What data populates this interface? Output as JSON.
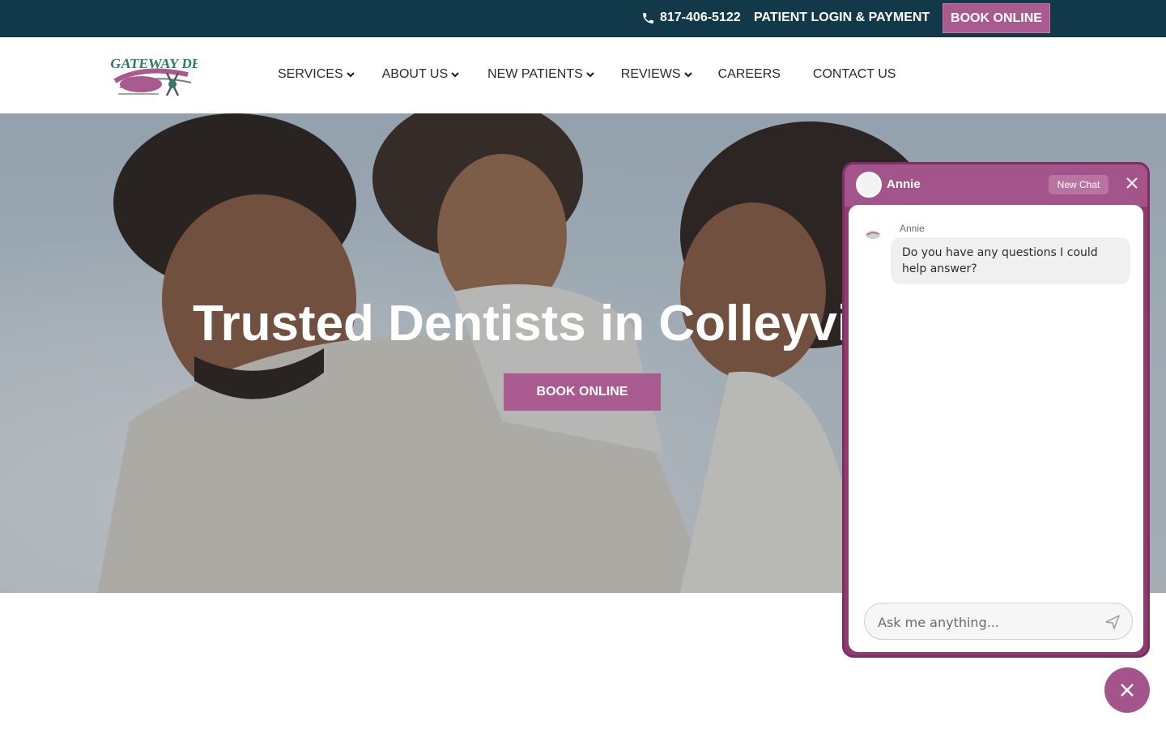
{
  "topbar": {
    "phone": "817-406-5122",
    "login": "PATIENT LOGIN & PAYMENT",
    "book": "BOOK ONLINE",
    "icons": {
      "phone": "phone-icon"
    },
    "colors": {
      "background": "#12394a",
      "accent": "#a95a8f"
    }
  },
  "nav": {
    "logo_text": "GATEWAY DENTAL",
    "items": [
      {
        "label": "SERVICES",
        "dropdown": true
      },
      {
        "label": "ABOUT US",
        "dropdown": true
      },
      {
        "label": "NEW PATIENTS",
        "dropdown": true
      },
      {
        "label": "REVIEWS",
        "dropdown": true
      },
      {
        "label": "CAREERS",
        "dropdown": false
      },
      {
        "label": "CONTACT US",
        "dropdown": false
      }
    ]
  },
  "hero": {
    "heading": "Trusted Dentists in Colleyvil",
    "cta": "BOOK ONLINE"
  },
  "chat": {
    "agent_name": "Annie",
    "new_chat": "New Chat",
    "messages": [
      {
        "sender": "Annie",
        "text": "Do you have any questions I could help answer?"
      }
    ],
    "input_placeholder": "Ask me anything...",
    "colors": {
      "header": "#a3548a",
      "frame": "#8c3d6e"
    }
  }
}
